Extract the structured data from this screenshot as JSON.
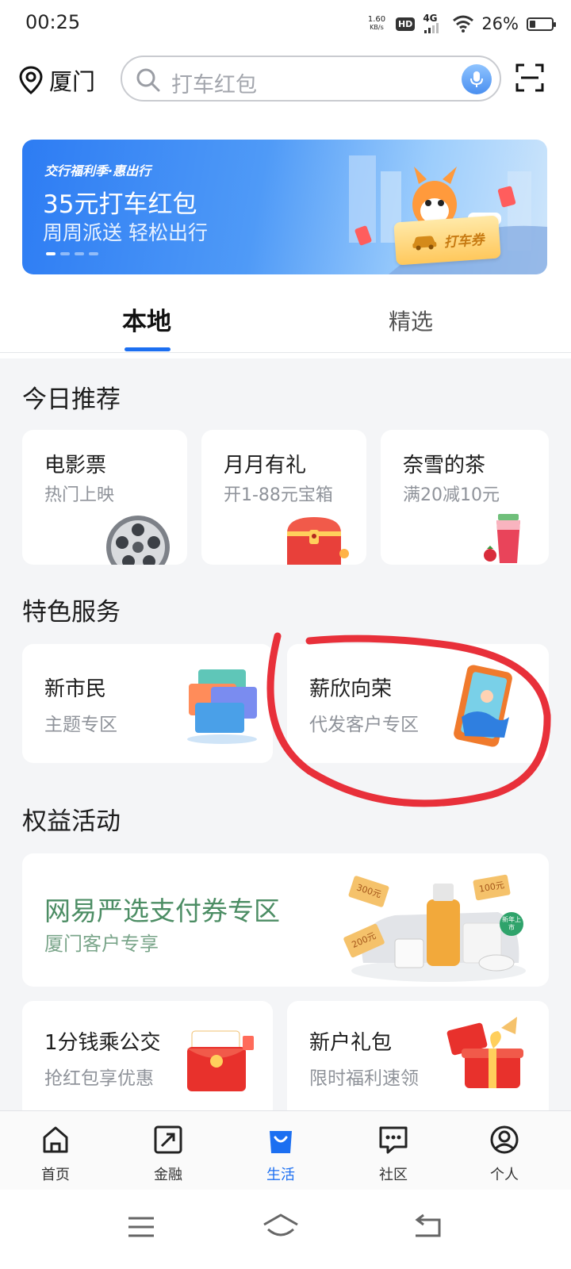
{
  "status": {
    "time": "00:25",
    "speed_value": "1.60",
    "speed_unit": "KB/s",
    "hd": "HD",
    "network": "4G",
    "battery_pct": "26%",
    "battery_level": 0.26
  },
  "header": {
    "city": "厦门",
    "search_placeholder": "打车红包"
  },
  "banner": {
    "tag": "交行福利季·惠出行",
    "title": "35元打车红包",
    "subtitle": "周周派送 轻松出行",
    "coupon": "打车券",
    "page_count": 4,
    "active_page": 1
  },
  "tabs": [
    {
      "label": "本地",
      "active": true
    },
    {
      "label": "精选",
      "active": false
    }
  ],
  "today": {
    "title": "今日推荐",
    "cards": [
      {
        "title": "电影票",
        "subtitle": "热门上映",
        "icon": "film-reel-icon"
      },
      {
        "title": "月月有礼",
        "subtitle": "开1-88元宝箱",
        "icon": "treasure-chest-icon"
      },
      {
        "title": "奈雪的茶",
        "subtitle": "满20减10元",
        "icon": "tea-cup-icon"
      }
    ]
  },
  "features": {
    "title": "特色服务",
    "cards": [
      {
        "title": "新市民",
        "subtitle": "主题专区",
        "icon": "cards-stack-icon"
      },
      {
        "title": "薪欣向荣",
        "subtitle": "代发客户专区",
        "icon": "phone-wave-icon"
      }
    ]
  },
  "benefits": {
    "title": "权益活动",
    "main": {
      "title": "网易严选支付券专区",
      "subtitle": "厦门客户专享",
      "coupons": [
        "300元",
        "200元",
        "100元"
      ],
      "badge": "新年上市"
    },
    "cards": [
      {
        "title": "1分钱乘公交",
        "subtitle": "抢红包享优惠",
        "icon": "red-envelope-icon"
      },
      {
        "title": "新户礼包",
        "subtitle": "限时福利速领",
        "icon": "gift-box-icon"
      }
    ]
  },
  "bottom_nav": [
    {
      "label": "首页",
      "icon": "home-icon",
      "active": false
    },
    {
      "label": "金融",
      "icon": "finance-icon",
      "active": false
    },
    {
      "label": "生活",
      "icon": "life-bag-icon",
      "active": true
    },
    {
      "label": "社区",
      "icon": "chat-icon",
      "active": false
    },
    {
      "label": "个人",
      "icon": "user-icon",
      "active": false
    }
  ],
  "colors": {
    "accent": "#1c6ff1",
    "highlight_circle": "#e8303a",
    "benefit_title": "#4c8d64"
  }
}
